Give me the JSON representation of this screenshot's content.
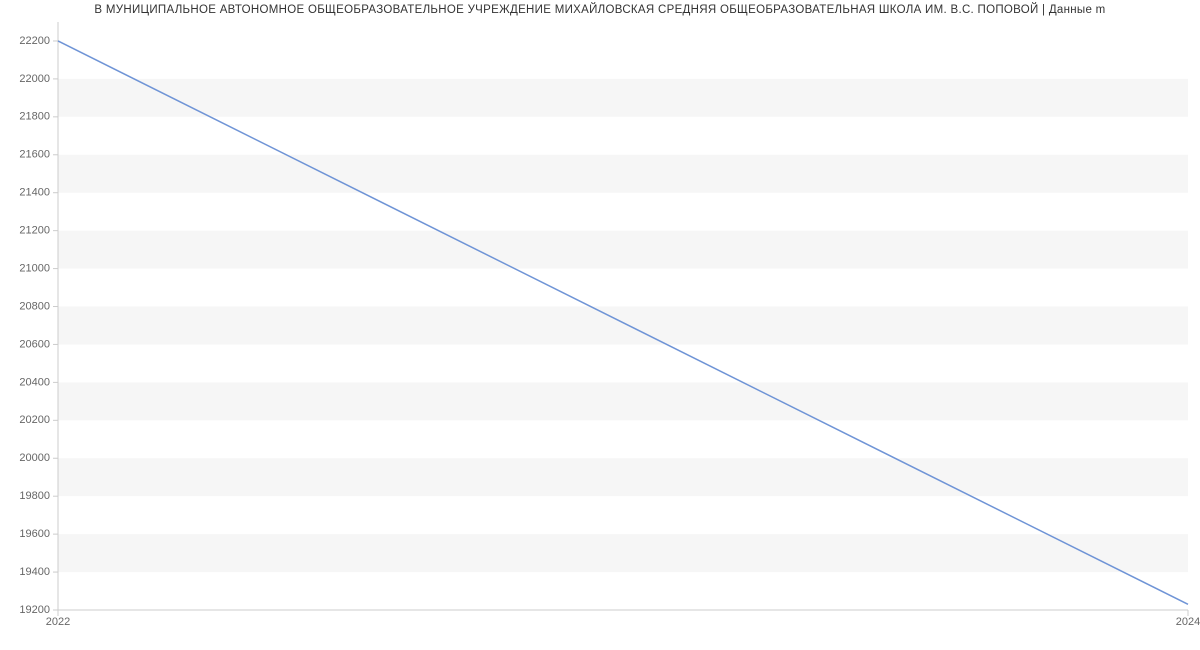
{
  "chart_data": {
    "type": "line",
    "title": "В МУНИЦИПАЛЬНОЕ АВТОНОМНОЕ ОБЩЕОБРАЗОВАТЕЛЬНОЕ УЧРЕЖДЕНИЕ МИХАЙЛОВСКАЯ СРЕДНЯЯ ОБЩЕОБРАЗОВАТЕЛЬНАЯ ШКОЛА ИМ. В.С. ПОПОВОЙ | Данные m",
    "x": [
      2022,
      2024
    ],
    "values": [
      22200,
      19230
    ],
    "xlabel": "",
    "ylabel": "",
    "x_ticks": [
      2022,
      2024
    ],
    "y_ticks": [
      19200,
      19400,
      19600,
      19800,
      20000,
      20200,
      20400,
      20600,
      20800,
      21000,
      21200,
      21400,
      21600,
      21800,
      22000,
      22200
    ],
    "ylim": [
      19200,
      22300
    ],
    "xlim": [
      2022,
      2024
    ],
    "line_color": "#6f94d6"
  }
}
